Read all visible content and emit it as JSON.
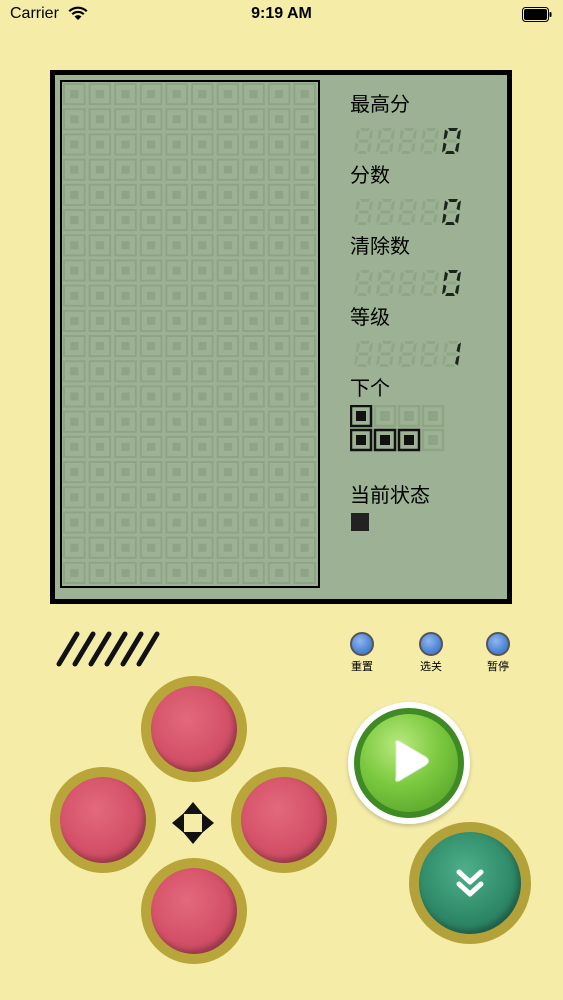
{
  "status_bar": {
    "carrier": "Carrier",
    "time": "9:19 AM"
  },
  "panel": {
    "high_score_label": "最高分",
    "high_score_value": "0",
    "score_label": "分数",
    "score_value": "0",
    "cleared_label": "清除数",
    "cleared_value": "0",
    "level_label": "等级",
    "level_value": "1",
    "next_label": "下个",
    "state_label": "当前状态",
    "ghost_digits": "88888"
  },
  "controls": {
    "reset_label": "重置",
    "select_level_label": "选关",
    "pause_label": "暂停",
    "up_icon": "up-button",
    "left_icon": "left-button",
    "right_icon": "right-button",
    "down_icon": "down-button",
    "play_icon": "play-icon",
    "drop_icon": "double-chevron-down-icon"
  },
  "next_piece": {
    "cells": [
      [
        1,
        0,
        0,
        0
      ],
      [
        1,
        1,
        1,
        0
      ]
    ]
  },
  "board": {
    "columns": 10,
    "rows": 20
  },
  "colors": {
    "background": "#f5eca8",
    "screen": "#9db294",
    "dpad": "#d45168",
    "play": "#7cc940",
    "drop": "#2f8a68",
    "small_button": "#4f86d6"
  }
}
